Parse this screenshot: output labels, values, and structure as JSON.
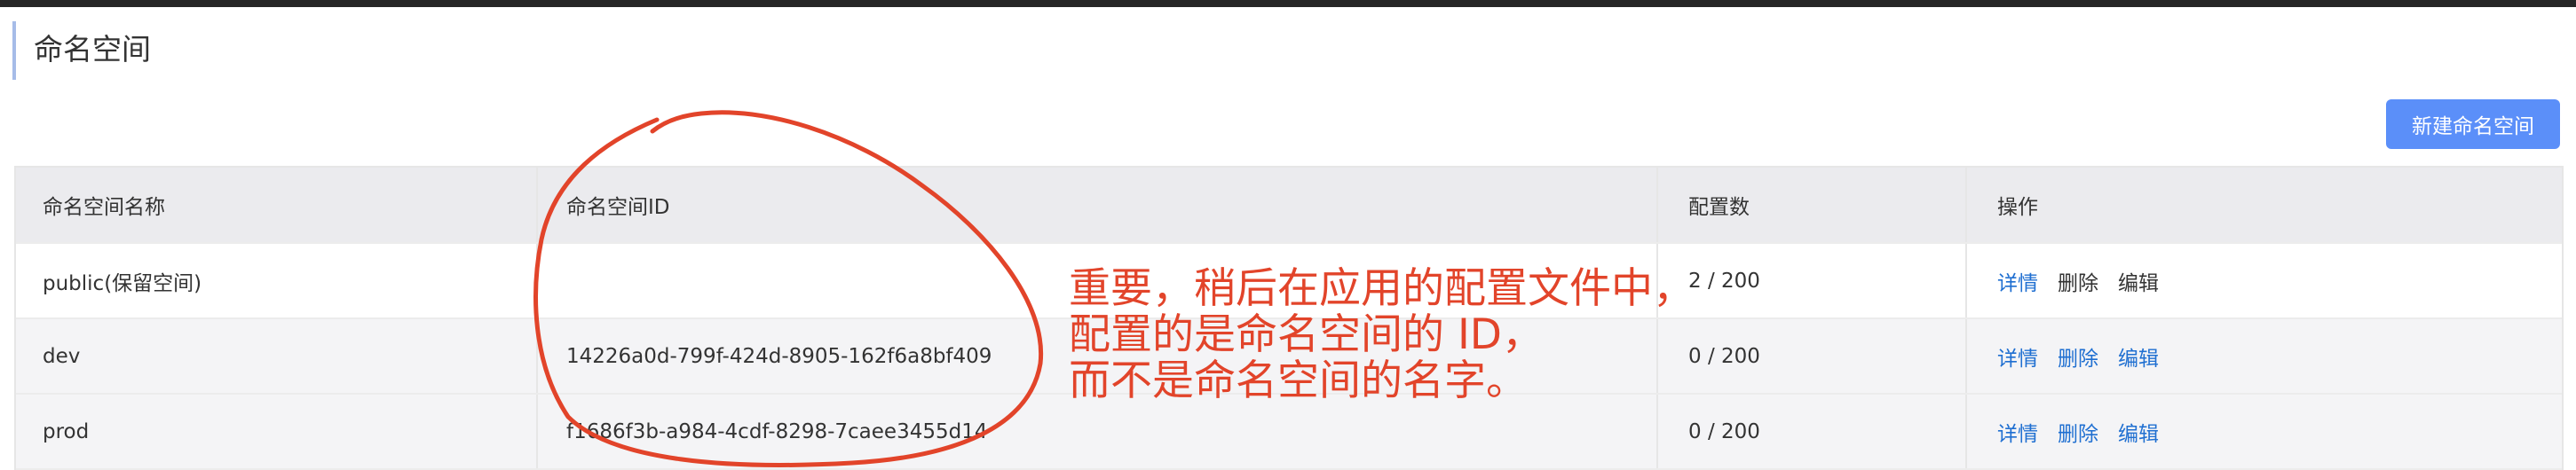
{
  "page": {
    "title": "命名空间"
  },
  "toolbar": {
    "new_button_label": "新建命名空间"
  },
  "table": {
    "headers": [
      "命名空间名称",
      "命名空间ID",
      "配置数",
      "操作"
    ],
    "rows": [
      {
        "name": "public(保留空间)",
        "id": "",
        "count": "2 / 200",
        "actions": [
          "详情",
          "删除",
          "编辑"
        ]
      },
      {
        "name": "dev",
        "id": "14226a0d-799f-424d-8905-162f6a8bf409",
        "count": "0 / 200",
        "actions": [
          "详情",
          "删除",
          "编辑"
        ]
      },
      {
        "name": "prod",
        "id": "f1686f3b-a984-4cdf-8298-7caee3455d14",
        "count": "0 / 200",
        "actions": [
          "详情",
          "删除",
          "编辑"
        ]
      }
    ]
  },
  "annotation": {
    "lines": [
      "重要，稍后在应用的配置文件中，",
      "配置的是命名空间的 ID，",
      "而不是命名空间的名字。"
    ],
    "color": "#e2442a"
  },
  "colors": {
    "accent": "#5b8ff9",
    "link": "#1f6fd1",
    "annotation": "#e2442a"
  }
}
